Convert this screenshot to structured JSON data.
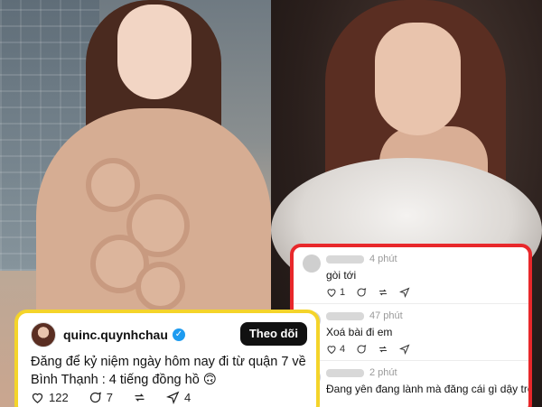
{
  "post": {
    "username": "quinc.quynhchau",
    "follow_label": "Theo dõi",
    "text": "Đăng để kỷ niệm ngày hôm nay đi từ quận 7 về Bình Thạnh : 4 tiếng đồng hồ 🙃",
    "likes": "122",
    "comments": "7",
    "shares": "4",
    "accent_color": "#f4d42a"
  },
  "comments_panel": {
    "border_color": "#e8282b",
    "items": [
      {
        "time": "4 phút",
        "text": "gòi tới",
        "likes": "1",
        "comments": ""
      },
      {
        "time": "47 phút",
        "text": "Xoá bài đi em",
        "likes": "4",
        "comments": ""
      },
      {
        "time": "2 phút",
        "text": "Đang yên đang lành mà đăng cái gì dậy trời",
        "likes": "",
        "comments": ""
      }
    ]
  }
}
